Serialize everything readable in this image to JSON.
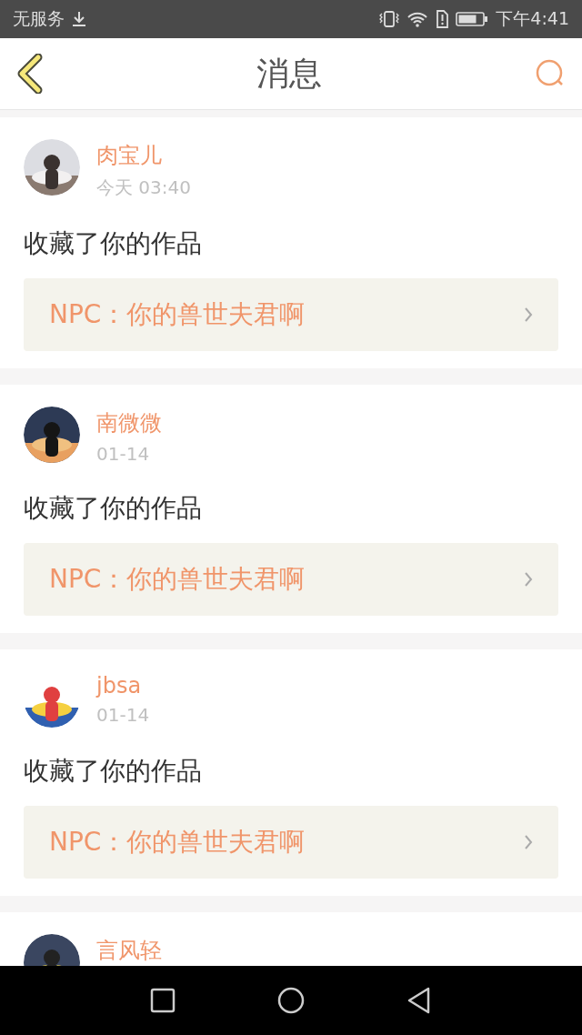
{
  "status_bar": {
    "carrier": "无服务",
    "time": "下午4:41"
  },
  "header": {
    "title": "消息"
  },
  "messages": [
    {
      "name": "肉宝儿",
      "time": "今天 03:40",
      "action": "收藏了你的作品",
      "work": "NPC：你的兽世夫君啊"
    },
    {
      "name": "南微微",
      "time": "01-14",
      "action": "收藏了你的作品",
      "work": "NPC：你的兽世夫君啊"
    },
    {
      "name": "jbsa",
      "time": "01-14",
      "action": "收藏了你的作品",
      "work": "NPC：你的兽世夫君啊"
    },
    {
      "name": "言风轻"
    }
  ]
}
